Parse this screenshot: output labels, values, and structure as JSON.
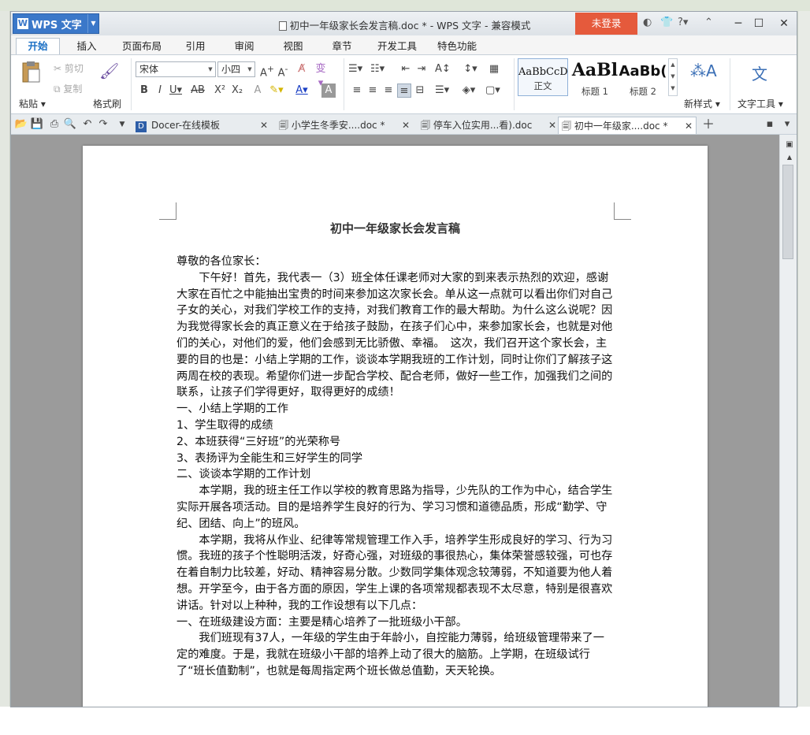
{
  "app": {
    "brand": "WPS 文字",
    "brand_letter": "W",
    "title": "初中一年级家长会发言稿.doc * - WPS 文字 - 兼容模式",
    "login": "未登录"
  },
  "tabs": [
    "开始",
    "插入",
    "页面布局",
    "引用",
    "审阅",
    "视图",
    "章节",
    "开发工具",
    "特色功能"
  ],
  "ribbon": {
    "paste": "粘贴",
    "cut": "剪切",
    "copy": "复制",
    "format_painter": "格式刷",
    "font": "宋体",
    "size": "小四",
    "styles": [
      {
        "sample": "AaBbCcD",
        "label": "正文"
      },
      {
        "sample": "AaBl",
        "label": "标题 1"
      },
      {
        "sample": "AaBb(",
        "label": "标题 2"
      }
    ],
    "new_style": "新样式",
    "text_tools": "文字工具"
  },
  "doc_tabs": [
    "Docer-在线模板",
    "小学生冬季安....doc *",
    "停车入位实用...看).doc",
    "初中一年级家....doc *"
  ],
  "document": {
    "title": "初中一年级家长会发言稿",
    "paragraphs": [
      "尊敬的各位家长：",
      "　　下午好！首先，我代表一（3）班全体任课老师对大家的到来表示热烈的欢迎，感谢大家在百忙之中能抽出宝贵的时间来参加这次家长会。单从这一点就可以看出你们对自己子女的关心，对我们学校工作的支持，对我们教育工作的最大帮助。为什么这么说呢？因为我觉得家长会的真正意义在于给孩子鼓励，在孩子们心中，来参加家长会，也就是对他们的关心，对他们的爱，他们会感到无比骄傲、幸福。　这次，我们召开这个家长会，主要的目的也是：小结上学期的工作，谈谈本学期我班的工作计划，同时让你们了解孩子这两周在校的表现。希望你们进一步配合学校、配合老师，做好一些工作，加强我们之间的联系，让孩子们学得更好，取得更好的成绩！",
      "一、小结上学期的工作",
      "1、学生取得的成绩",
      "2、本班获得“三好班”的光荣称号",
      "3、表扬评为全能生和三好学生的同学",
      "二、谈谈本学期的工作计划",
      "　　本学期，我的班主任工作以学校的教育思路为指导，少先队的工作为中心，结合学生实际开展各项活动。目的是培养学生良好的行为、学习习惯和道德品质，形成“勤学、守纪、团结、向上”的班风。",
      "　　本学期，我将从作业、纪律等常规管理工作入手，培养学生形成良好的学习、行为习惯。我班的孩子个性聪明活泼，好奇心强，对班级的事很热心，集体荣誉感较强，可也存在着自制力比较差，好动、精神容易分散。少数同学集体观念较薄弱，不知道要为他人着想。开学至今，由于各方面的原因，学生上课的各项常规都表现不太尽意，特别是很喜欢讲话。针对以上种种，我的工作设想有以下几点：",
      "一、在班级建设方面：主要是精心培养了一批班级小干部。",
      "　　我们班现有37人，一年级的学生由于年龄小，自控能力薄弱，给班级管理带来了一定的难度。于是，我就在班级小干部的培养上动了很大的脑筋。上学期，在班级试行了“班长值勤制”，也就是每周指定两个班长做总值勤，天天轮换。"
    ]
  }
}
